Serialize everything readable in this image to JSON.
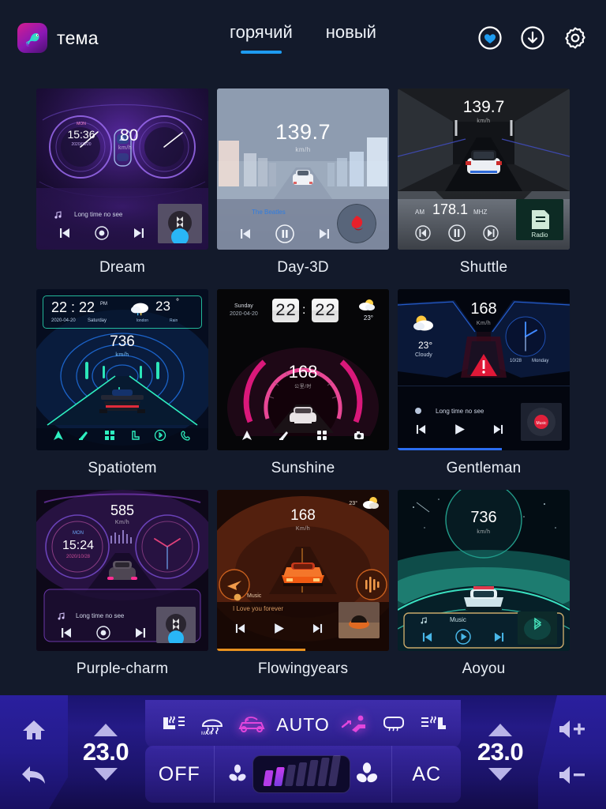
{
  "header": {
    "brand_title": "тема",
    "logo_icon": "chameleon-logo-icon",
    "tabs": [
      {
        "label": "горячий",
        "active": true
      },
      {
        "label": "новый",
        "active": false
      }
    ],
    "actions": [
      {
        "name": "favorites-icon",
        "label": "heart-icon"
      },
      {
        "name": "downloads-icon",
        "label": "download-icon"
      },
      {
        "name": "settings-icon",
        "label": "gear-icon"
      }
    ]
  },
  "themes": [
    {
      "label": "Dream",
      "speed": "80",
      "speed_unit": "km/h",
      "clock": "15:36",
      "clock_meta": "MON",
      "date": "2020/05/20",
      "track": "Long time no see",
      "art": "bluetooth-album-art",
      "accent": "#8b5cf6"
    },
    {
      "label": "Day-3D",
      "speed": "139.7",
      "speed_unit": "km/h",
      "track": "The Beatles",
      "art": "rose-album-art",
      "accent": "#3e8bd6"
    },
    {
      "label": "Shuttle",
      "speed": "139.7",
      "speed_unit": "km/h",
      "radio_band": "AM",
      "radio_freq": "178.1",
      "radio_unit": "MHZ",
      "art": "radio-album-art",
      "accent": "#9aa2ad"
    },
    {
      "label": "Spatiotem",
      "speed": "736",
      "speed_unit": "km/h",
      "clock": "22 : 22",
      "clock_meta": "PM",
      "date": "2020-04-20",
      "weekday": "Saturday",
      "temp": "23",
      "temp_unit": "°",
      "city": "london",
      "weather": "Rain",
      "dock_icons": [
        "navigation-icon",
        "wiper-icon",
        "apps-icon",
        "seat-icon",
        "bluetooth-icon",
        "phone-icon"
      ],
      "accent": "#2ee6c6"
    },
    {
      "label": "Sunshine",
      "speed": "168",
      "speed_unit": "公里/时",
      "clock_hh": "22",
      "clock_sep": ":",
      "clock_mm": "22",
      "weekday": "Sunday",
      "date": "2020-04-20",
      "temp": "23°",
      "dock_icons": [
        "navigation-icon",
        "wiper-icon",
        "apps-icon",
        "camera-icon"
      ],
      "accent": "#e5197f"
    },
    {
      "label": "Gentleman",
      "speed": "168",
      "speed_unit": "Km/h",
      "temp": "23°",
      "weather": "Cloudy",
      "date": "10/28",
      "weekday": "Monday",
      "track": "Long time no see",
      "art": "music-album-art",
      "warning": "warning-triangle-icon",
      "accent": "#2b6df0"
    },
    {
      "label": "Purple-charm",
      "speed": "585",
      "speed_unit": "Km/h",
      "clock": "15:24",
      "clock_meta": "MON",
      "date": "2020/10/28",
      "track": "Long time no see",
      "art": "bluetooth-album-art",
      "accent": "#b14ce0"
    },
    {
      "label": "Flowingyears",
      "speed": "168",
      "speed_unit": "Km/h",
      "temp": "23°",
      "track_label": "Music",
      "track": "I Love you forever",
      "art": "orange-album-art",
      "accent": "#ef7a2a"
    },
    {
      "label": "Aoyou",
      "speed": "736",
      "speed_unit": "km/h",
      "track": "Music",
      "art": "bluetooth-album-art",
      "accent": "#37d8bd"
    }
  ],
  "climate": {
    "home_icon": "home-icon",
    "back_icon": "back-arrow-icon",
    "volume_up_icon": "volume-up-icon",
    "volume_down_icon": "volume-down-icon",
    "temp_left": "23.0",
    "temp_right": "23.0",
    "functions": [
      {
        "name": "seat-heat-icon",
        "active": false
      },
      {
        "name": "max-defrost-icon",
        "active": false
      },
      {
        "name": "recirculation-icon",
        "active": true
      },
      {
        "name": "auto-label",
        "label": "AUTO",
        "active": false
      },
      {
        "name": "airflow-person-icon",
        "active": true
      },
      {
        "name": "rear-defrost-icon",
        "active": false
      },
      {
        "name": "seat-vent-icon",
        "active": false
      }
    ],
    "off_label": "OFF",
    "ac_label": "AC",
    "fan_down_icon": "fan-decrease-icon",
    "fan_up_icon": "fan-increase-icon",
    "fan_level": 2,
    "fan_level_max": 7,
    "active_color": "#e246dc",
    "bar_color": "#b43ce8"
  }
}
